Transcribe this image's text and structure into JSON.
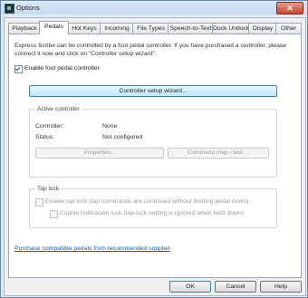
{
  "window": {
    "title": "Options",
    "close_glyph": "✕"
  },
  "tabs": [
    {
      "label": "Playback"
    },
    {
      "label": "Pedals"
    },
    {
      "label": "Hot Keys"
    },
    {
      "label": "Incoming"
    },
    {
      "label": "File Types"
    },
    {
      "label": "Speech-to-Text"
    },
    {
      "label": "Dock Undock"
    },
    {
      "label": "Display"
    },
    {
      "label": "Other"
    }
  ],
  "active_tab": "Pedals",
  "pedals": {
    "description": "Express Scribe can be controlled by a foot pedal controller. If you have purchased a controller, please connect it now and click on \"Controller setup wizard\".",
    "enable_label": "Enable foot pedal controller",
    "enable_checked": true,
    "setup_wizard_button": "Controller setup wizard...",
    "active_controller": {
      "title": "Active controller",
      "controller_label": "Controller:",
      "controller_value": "None",
      "status_label": "Status:",
      "status_value": "Not configured",
      "properties_button": "Properties...",
      "command_map_button": "Command map / test ..."
    },
    "tap_lock": {
      "title": "Tap lock",
      "enable_tap_lock_label": "Enable tap lock (tap commands are continued without holding pedal down)",
      "enable_tap_lock_checked": false,
      "enable_hold_label": "Enable hold-down lock (tap-lock setting is ignored when held down)",
      "enable_hold_checked": false
    },
    "purchase_link": "Purchase compatible pedals from recommended supplier"
  },
  "footer": {
    "ok": "OK",
    "cancel": "Cancel",
    "help": "Help"
  }
}
